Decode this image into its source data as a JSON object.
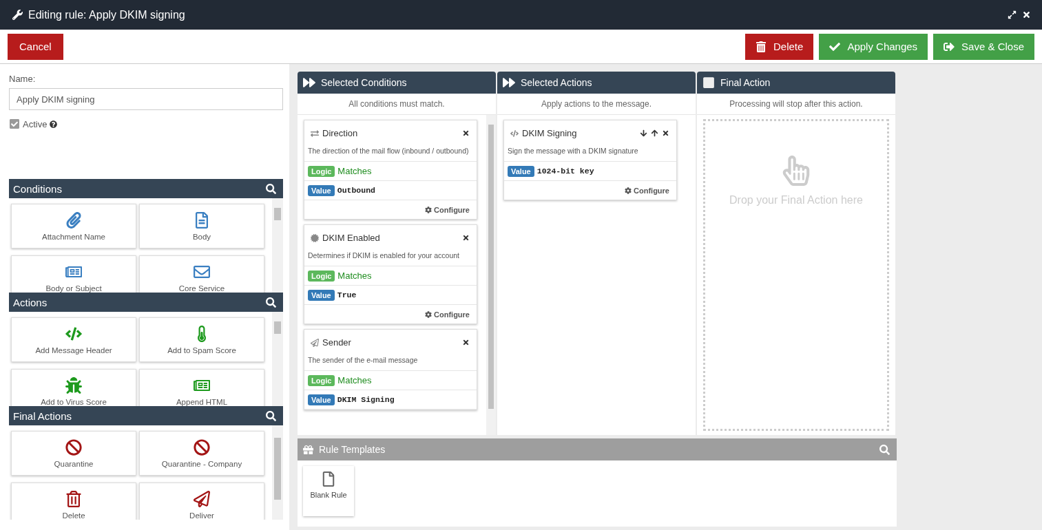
{
  "window": {
    "title": "Editing rule: Apply DKIM signing"
  },
  "toolbar": {
    "left": [
      {
        "label": "Cancel",
        "kind": "cancel"
      }
    ],
    "right": [
      {
        "label": "Delete",
        "kind": "delete"
      },
      {
        "label": "Apply Changes",
        "kind": "apply"
      },
      {
        "label": "Save & Close",
        "kind": "save"
      }
    ]
  },
  "rule": {
    "name_label": "Name:",
    "name": "Apply DKIM signing",
    "active": {
      "label": "Active",
      "checked": true
    }
  },
  "palettes": [
    {
      "title": "Conditions",
      "kind": "condition",
      "items": [
        "Attachment Name",
        "Body",
        "Body or Subject",
        "Core Service"
      ]
    },
    {
      "title": "Actions",
      "kind": "action",
      "items": [
        "Add Message Header",
        "Add to Spam Score",
        "Add to Virus Score",
        "Append HTML"
      ]
    },
    {
      "title": "Final Actions",
      "kind": "final",
      "items": [
        "Quarantine",
        "Quarantine - Company",
        "Delete",
        "Deliver"
      ]
    }
  ],
  "columns": [
    {
      "title": "Selected Conditions",
      "subtitle": "All conditions must match.",
      "kind": "list",
      "cards": [
        {
          "title": "Direction",
          "description": "The direction of the mail flow (inbound / outbound)",
          "movable": false,
          "rows": [
            {
              "tag": "Logic",
              "kind": "logic",
              "value": "Matches"
            },
            {
              "tag": "Value",
              "kind": "value",
              "value": "Outbound"
            }
          ],
          "footer": "Configure"
        },
        {
          "title": "DKIM Enabled",
          "description": "Determines if DKIM is enabled for your account",
          "movable": false,
          "rows": [
            {
              "tag": "Logic",
              "kind": "logic",
              "value": "Matches"
            },
            {
              "tag": "Value",
              "kind": "value",
              "value": "True"
            }
          ],
          "footer": "Configure"
        },
        {
          "title": "Sender",
          "description": "The sender of the e-mail message",
          "movable": false,
          "rows": [
            {
              "tag": "Logic",
              "kind": "logic",
              "value": "Matches"
            },
            {
              "tag": "Value",
              "kind": "value",
              "value": "DKIM Signing"
            }
          ]
        }
      ]
    },
    {
      "title": "Selected Actions",
      "subtitle": "Apply actions to the message.",
      "kind": "list",
      "cards": [
        {
          "title": "DKIM Signing",
          "description": "Sign the message with a DKIM signature",
          "movable": true,
          "rows": [
            {
              "tag": "Value",
              "kind": "value",
              "value": "1024-bit key"
            }
          ],
          "footer": "Configure"
        }
      ]
    },
    {
      "title": "Final Action",
      "subtitle": "Processing will stop after this action.",
      "kind": "drop",
      "placeholder": "Drop your Final Action here"
    }
  ],
  "templates": {
    "title": "Rule Templates",
    "items": [
      "Blank Rule"
    ]
  }
}
